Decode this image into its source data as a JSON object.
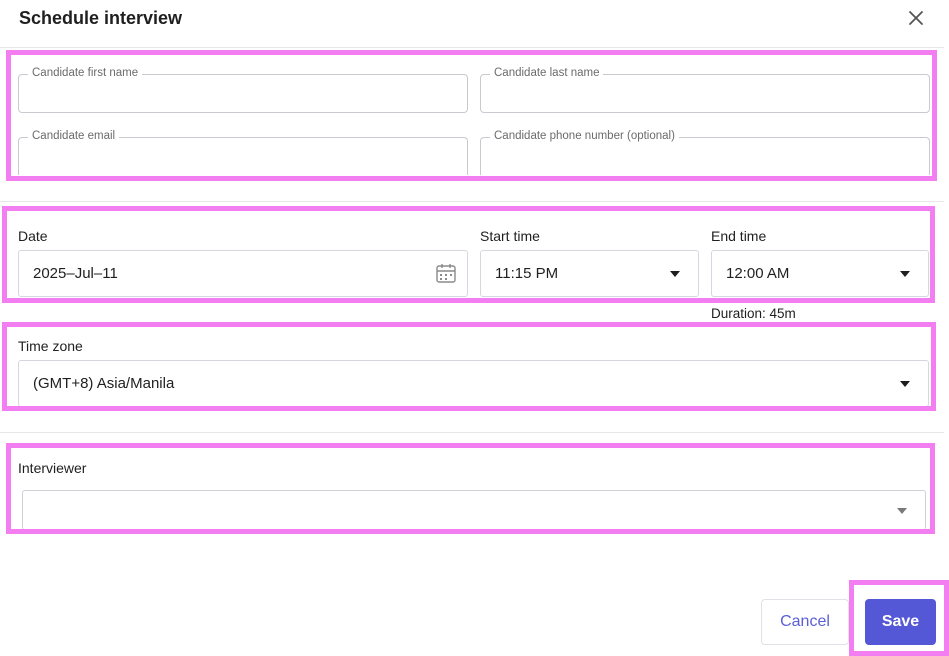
{
  "dialog": {
    "title": "Schedule interview"
  },
  "candidate": {
    "first_name_label": "Candidate first name",
    "first_name_value": "",
    "last_name_label": "Candidate last name",
    "last_name_value": "",
    "email_label": "Candidate email",
    "email_value": "",
    "phone_label": "Candidate phone number (optional)",
    "phone_value": ""
  },
  "schedule": {
    "date_label": "Date",
    "date_value": "2025–Jul–11",
    "start_label": "Start time",
    "start_value": "11:15 PM",
    "end_label": "End time",
    "end_value": "12:00 AM",
    "duration": "Duration: 45m"
  },
  "timezone": {
    "label": "Time zone",
    "value": "(GMT+8) Asia/Manila"
  },
  "interviewer": {
    "label": "Interviewer",
    "value": ""
  },
  "actions": {
    "cancel_label": "Cancel",
    "save_label": "Save"
  },
  "icons": {
    "close": "close-icon",
    "calendar": "calendar-icon",
    "dropdown": "chevron-down-icon"
  },
  "colors": {
    "accent": "#5457d6",
    "highlight": "#f27ef2",
    "border": "#c9c9d0"
  }
}
